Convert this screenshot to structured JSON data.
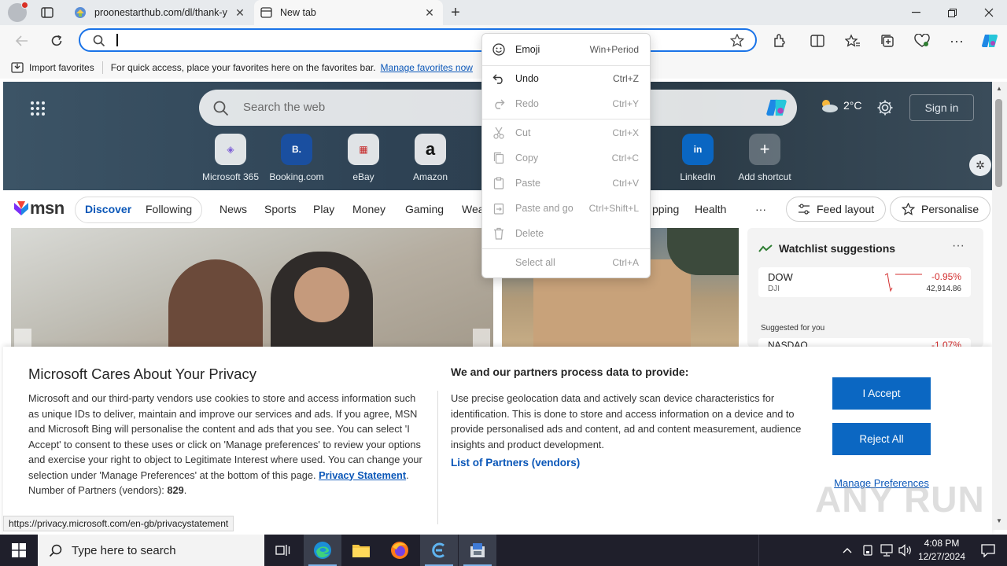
{
  "browser": {
    "tabs": [
      {
        "title": "proonestarthub.com/dl/thank-y",
        "active": false
      },
      {
        "title": "New tab",
        "active": true
      }
    ],
    "address": {
      "value": "",
      "placeholder": ""
    }
  },
  "favorites_bar": {
    "import_label": "Import favorites",
    "hint": "For quick access, place your favorites here on the favorites bar.",
    "manage_link": "Manage favorites now"
  },
  "context_menu": {
    "items": [
      {
        "label": "Emoji",
        "shortcut": "Win+Period",
        "enabled": true
      },
      {
        "label": "Undo",
        "shortcut": "Ctrl+Z",
        "enabled": true
      },
      {
        "label": "Redo",
        "shortcut": "Ctrl+Y",
        "enabled": false
      },
      {
        "label": "Cut",
        "shortcut": "Ctrl+X",
        "enabled": false
      },
      {
        "label": "Copy",
        "shortcut": "Ctrl+C",
        "enabled": false
      },
      {
        "label": "Paste",
        "shortcut": "Ctrl+V",
        "enabled": false
      },
      {
        "label": "Paste and go",
        "shortcut": "Ctrl+Shift+L",
        "enabled": false
      },
      {
        "label": "Delete",
        "shortcut": "",
        "enabled": false
      },
      {
        "label": "Select all",
        "shortcut": "Ctrl+A",
        "enabled": false
      }
    ]
  },
  "newtab": {
    "search_placeholder": "Search the web",
    "weather": "2°C",
    "signin": "Sign in",
    "shortcuts": [
      {
        "label": "Microsoft 365",
        "glyph": "◈"
      },
      {
        "label": "Booking.com",
        "glyph": "B."
      },
      {
        "label": "eBay",
        "glyph": "▦"
      },
      {
        "label": "Amazon",
        "glyph": "a"
      },
      {
        "label": "LinkedIn",
        "glyph": "in"
      },
      {
        "label": "Add shortcut",
        "glyph": "+"
      }
    ],
    "msn_logo": "msn",
    "nav": [
      "Discover",
      "Following",
      "News",
      "Sports",
      "Play",
      "Money",
      "Gaming",
      "Wea",
      "pping",
      "Health",
      "···"
    ],
    "feed_layout": "Feed layout",
    "personalise": "Personalise",
    "watchlist": {
      "title": "Watchlist suggestions",
      "stock": {
        "symbol": "DOW",
        "sub": "DJI",
        "change": "-0.95%",
        "price": "42,914.86"
      },
      "suggested": "Suggested for you",
      "next_symbol": "NASDAQ",
      "next_change": "-1.07%"
    }
  },
  "privacy": {
    "title": "Microsoft Cares About Your Privacy",
    "body": "Microsoft and our third-party vendors use cookies to store and access information such as unique IDs to deliver, maintain and improve our services and ads. If you agree, MSN and Microsoft Bing will personalise the content and ads that you see. You can select 'I Accept' to consent to these uses or click on 'Manage preferences' to review your options and exercise your right to object to Legitimate Interest where used.  You can change your selection under 'Manage Preferences' at the bottom of this page.",
    "privacy_link": "Privacy Statement",
    "partners_label": "Number of Partners (vendors):",
    "partners_count": "829",
    "data_title": "We and our partners process data to provide:",
    "data_text": "Use precise geolocation data and actively scan device characteristics for identification. This is done to store and access information on a device and to provide personalised ads and content, ad and content measurement, audience insights and product development.",
    "partners_link": "List of Partners (vendors)",
    "accept": "I Accept",
    "reject": "Reject All",
    "manage": "Manage Preferences"
  },
  "status_url": "https://privacy.microsoft.com/en-gb/privacystatement",
  "watermark": "ANY RUN",
  "taskbar": {
    "search_placeholder": "Type here to search",
    "time": "4:08 PM",
    "date": "12/27/2024"
  },
  "colors": {
    "accent": "#0b67c2",
    "address_focus": "#1a73e8",
    "taskbar": "#1f1f2b"
  }
}
